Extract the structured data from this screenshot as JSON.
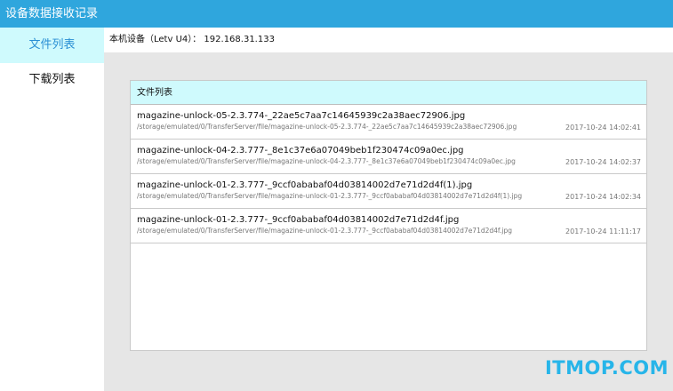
{
  "header": {
    "title": "设备数据接收记录"
  },
  "sidebar": {
    "items": [
      {
        "label": "文件列表",
        "active": true
      },
      {
        "label": "下载列表",
        "active": false
      }
    ]
  },
  "device": {
    "label": "本机设备（Letv U4）： 192.168.31.133"
  },
  "file_panel": {
    "title": "文件列表",
    "files": [
      {
        "name": "magazine-unlock-05-2.3.774-_22ae5c7aa7c14645939c2a38aec72906.jpg",
        "path": "/storage/emulated/0/TransferServer/file/magazine-unlock-05-2.3.774-_22ae5c7aa7c14645939c2a38aec72906.jpg",
        "time": "2017-10-24 14:02:41"
      },
      {
        "name": "magazine-unlock-04-2.3.777-_8e1c37e6a07049beb1f230474c09a0ec.jpg",
        "path": "/storage/emulated/0/TransferServer/file/magazine-unlock-04-2.3.777-_8e1c37e6a07049beb1f230474c09a0ec.jpg",
        "time": "2017-10-24 14:02:37"
      },
      {
        "name": "magazine-unlock-01-2.3.777-_9ccf0ababaf04d03814002d7e71d2d4f(1).jpg",
        "path": "/storage/emulated/0/TransferServer/file/magazine-unlock-01-2.3.777-_9ccf0ababaf04d03814002d7e71d2d4f(1).jpg",
        "time": "2017-10-24 14:02:34"
      },
      {
        "name": "magazine-unlock-01-2.3.777-_9ccf0ababaf04d03814002d7e71d2d4f.jpg",
        "path": "/storage/emulated/0/TransferServer/file/magazine-unlock-01-2.3.777-_9ccf0ababaf04d03814002d7e71d2d4f.jpg",
        "time": "2017-10-24 11:11:17"
      }
    ]
  },
  "watermark": {
    "text": "ITMOP.COM"
  },
  "colors": {
    "titlebar": "#2fa6dd",
    "accent_bg": "#cffafd",
    "active_text": "#2a8fd4",
    "background": "#e6e6e6",
    "watermark": "#27b5e9"
  }
}
